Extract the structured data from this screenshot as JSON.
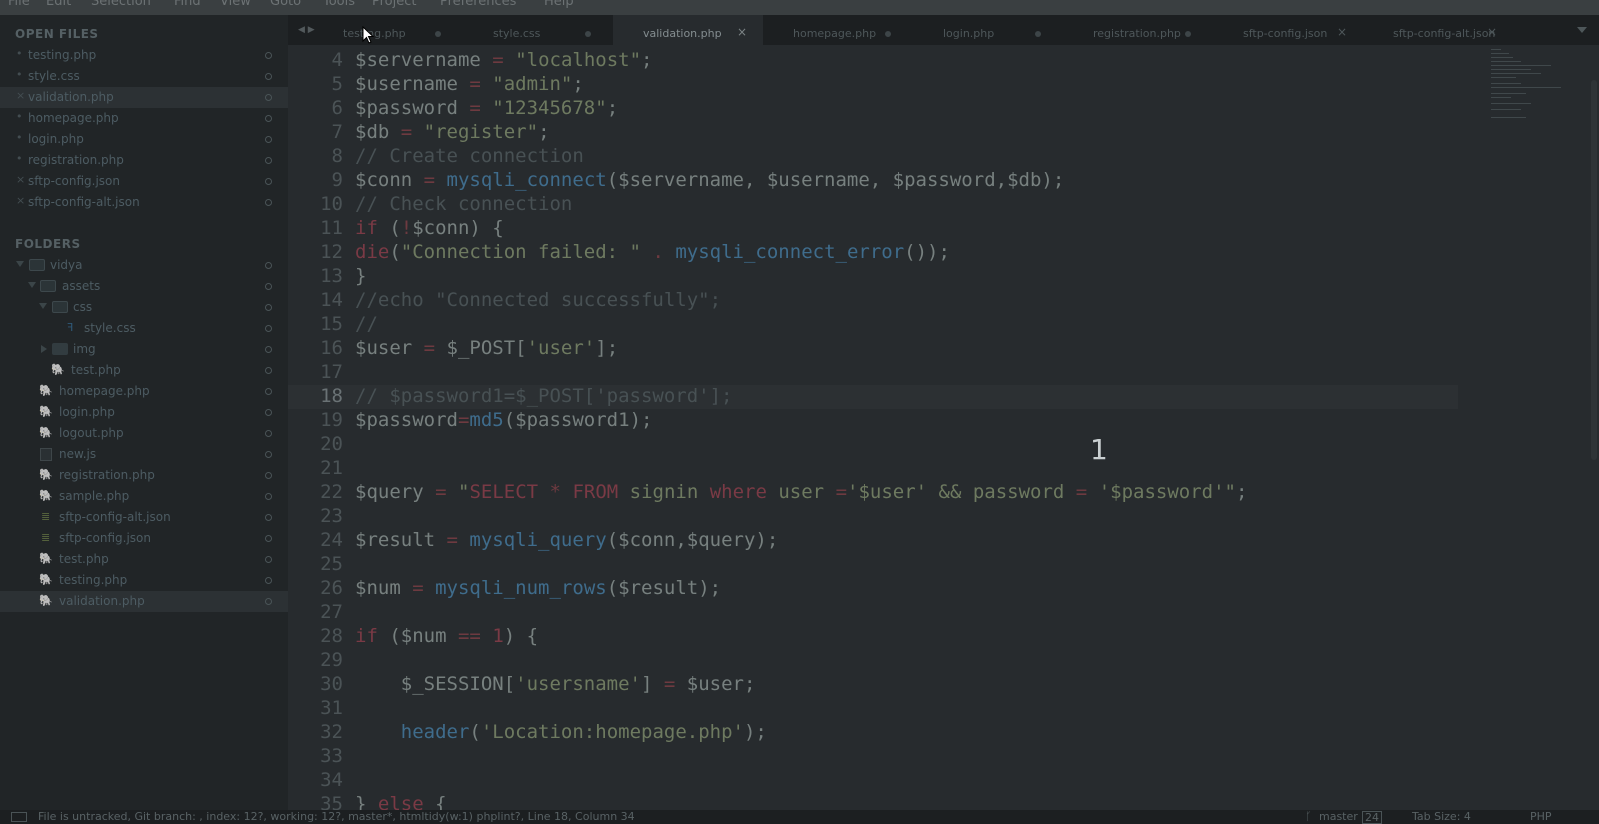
{
  "menu": [
    "File",
    "Edit",
    "Selection",
    "Find",
    "View",
    "Goto",
    "Tools",
    "Project",
    "Preferences",
    "Help"
  ],
  "sidebar": {
    "open_files_heading": "OPEN FILES",
    "open_files": [
      {
        "name": "testing.php",
        "mark": "•"
      },
      {
        "name": "style.css",
        "mark": "•"
      },
      {
        "name": "validation.php",
        "mark": "×"
      },
      {
        "name": "homepage.php",
        "mark": "•"
      },
      {
        "name": "login.php",
        "mark": "•"
      },
      {
        "name": "registration.php",
        "mark": "•"
      },
      {
        "name": "sftp-config.json",
        "mark": "×"
      },
      {
        "name": "sftp-config-alt.json",
        "mark": "×"
      }
    ],
    "folders_heading": "FOLDERS",
    "tree": [
      {
        "name": "vidya"
      },
      {
        "name": "assets"
      },
      {
        "name": "css"
      },
      {
        "name": "style.css"
      },
      {
        "name": "img"
      },
      {
        "name": "test.php"
      },
      {
        "name": "homepage.php"
      },
      {
        "name": "login.php"
      },
      {
        "name": "logout.php"
      },
      {
        "name": "new.js"
      },
      {
        "name": "registration.php"
      },
      {
        "name": "sample.php"
      },
      {
        "name": "sftp-config-alt.json"
      },
      {
        "name": "sftp-config.json"
      },
      {
        "name": "test.php"
      },
      {
        "name": "testing.php"
      },
      {
        "name": "validation.php"
      }
    ]
  },
  "tabs": [
    {
      "label": "testing.php",
      "close": ""
    },
    {
      "label": "style.css",
      "close": ""
    },
    {
      "label": "validation.php",
      "close": "×"
    },
    {
      "label": "homepage.php",
      "close": ""
    },
    {
      "label": "login.php",
      "close": ""
    },
    {
      "label": "registration.php",
      "close": ""
    },
    {
      "label": "sftp-config.json",
      "close": "×"
    },
    {
      "label": "sftp-config-alt.json",
      "close": "×"
    }
  ],
  "editor": {
    "line_numbers": [
      "4",
      "5",
      "6",
      "7",
      "8",
      "9",
      "10",
      "11",
      "12",
      "13",
      "14",
      "15",
      "16",
      "17",
      "18",
      "19",
      "20",
      "21",
      "22",
      "23",
      "24",
      "25",
      "26",
      "27",
      "28",
      "29",
      "30",
      "31",
      "32",
      "33",
      "34",
      "35"
    ],
    "overlay_text": "1"
  },
  "status": {
    "message": "File is untracked, Git branch: , index: 12?, working: 12?, master*, htmltidy(w:1) phplint?, Line 18, Column 34",
    "branch": "master",
    "branch_count": "24",
    "tab_size": "Tab Size: 4",
    "syntax": "PHP"
  },
  "colors": {
    "background": "#272b2e",
    "sidebar": "#212527",
    "keyword": "#7a3a45",
    "string": "#6e7a60",
    "function": "#3f6c8c"
  }
}
